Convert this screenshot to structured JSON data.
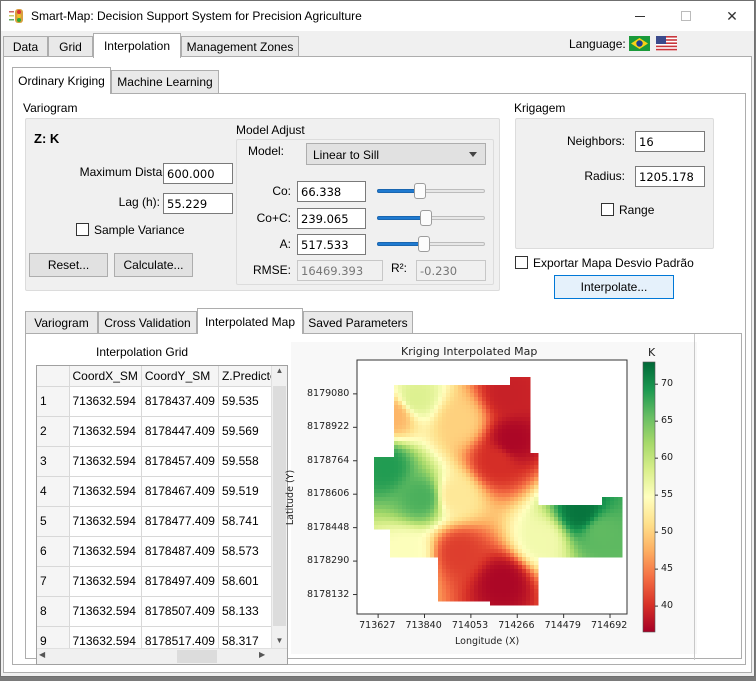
{
  "window": {
    "title": "Smart-Map: Decision Support System for Precision Agriculture",
    "icon": "traffic-light-icon",
    "controls": [
      "minimize-icon",
      "maximize-icon",
      "close-icon"
    ]
  },
  "main_tabs": [
    {
      "label": "Data",
      "active": false
    },
    {
      "label": "Grid",
      "active": false
    },
    {
      "label": "Interpolation",
      "active": true
    },
    {
      "label": "Management Zones",
      "active": false
    }
  ],
  "language": {
    "label": "Language:",
    "flags": [
      "brazil-flag-icon",
      "usa-flag-icon"
    ]
  },
  "method_tabs": [
    {
      "label": "Ordinary Kriging",
      "active": true
    },
    {
      "label": "Machine Learning",
      "active": false
    }
  ],
  "variogram": {
    "group_label": "Variogram",
    "z_label": "Z: K",
    "max_distance_label": "Maximum Distance:",
    "max_distance_value": "600.000",
    "lag_label": "Lag (h):",
    "lag_value": "55.229",
    "sample_variance_label": "Sample Variance",
    "sample_variance_checked": false,
    "reset_button": "Reset...",
    "calculate_button": "Calculate..."
  },
  "model_adjust": {
    "group_label": "Model Adjust",
    "model_label": "Model:",
    "model_value": "Linear to Sill",
    "co_label": "Co:",
    "co_value": "66.338",
    "co_slider_fraction": 0.39,
    "sill_label": "Co+C:",
    "sill_value": "239.065",
    "sill_slider_fraction": 0.45,
    "a_label": "A:",
    "a_value": "517.533",
    "a_slider_fraction": 0.43,
    "rmse_label": "RMSE:",
    "rmse_value": "16469.393",
    "r2_label": "R²:",
    "r2_value": "-0.230"
  },
  "krigagem": {
    "group_label": "Krigagem",
    "neighbors_label": "Neighbors:",
    "neighbors_value": "16",
    "radius_label": "Radius:",
    "radius_value": "1205.178",
    "range_label": "Range",
    "range_checked": false
  },
  "export_std_label": "Exportar Mapa Desvio Padrão",
  "export_std_checked": false,
  "interpolate_button": "Interpolate...",
  "result_tabs": [
    {
      "label": "Variogram",
      "active": false
    },
    {
      "label": "Cross Validation",
      "active": false
    },
    {
      "label": "Interpolated Map",
      "active": true
    },
    {
      "label": "Saved Parameters",
      "active": false
    }
  ],
  "grid_table": {
    "title": "Interpolation Grid",
    "columns": [
      "",
      "CoordX_SM",
      "CoordY_SM",
      "Z.Predicted"
    ],
    "rows": [
      [
        "1",
        "713632.594",
        "8178437.409",
        "59.535"
      ],
      [
        "2",
        "713632.594",
        "8178447.409",
        "59.569"
      ],
      [
        "3",
        "713632.594",
        "8178457.409",
        "59.558"
      ],
      [
        "4",
        "713632.594",
        "8178467.409",
        "59.519"
      ],
      [
        "5",
        "713632.594",
        "8178477.409",
        "58.741"
      ],
      [
        "6",
        "713632.594",
        "8178487.409",
        "58.573"
      ],
      [
        "7",
        "713632.594",
        "8178497.409",
        "58.601"
      ],
      [
        "8",
        "713632.594",
        "8178507.409",
        "58.133"
      ],
      [
        "9",
        "713632.594",
        "8178517.409",
        "58.317"
      ]
    ]
  },
  "chart_data": {
    "type": "heatmap",
    "title": "Kriging Interpolated Map",
    "xlabel": "Longitude (X)",
    "ylabel": "Latitude  (Y)",
    "x_ticks": [
      713627,
      713840,
      714053,
      714266,
      714479,
      714692
    ],
    "y_ticks": [
      8178132,
      8178290,
      8178448,
      8178606,
      8178764,
      8178922,
      8179080
    ],
    "xlim": [
      713530,
      714770
    ],
    "ylim": [
      8178040,
      8179240
    ],
    "colorbar": {
      "label": "K",
      "colormap": "RdYlGn",
      "ticks": [
        40,
        45,
        50,
        55,
        60,
        65,
        70
      ],
      "range": [
        36.5,
        73
      ]
    },
    "colormap_stops": [
      "#a50026",
      "#d73027",
      "#f46d43",
      "#fdae61",
      "#fee08b",
      "#ffffbf",
      "#d9ef8b",
      "#a6d96a",
      "#66bd63",
      "#1a9850",
      "#006837"
    ],
    "field_description": "Irregular field boundary; high K (green) in west and east lobes, low K (red) in north-east and south-central zones, transitional yellow band through the centre.",
    "hotspots": [
      {
        "x": 713660,
        "y": 8178740,
        "value": 69
      },
      {
        "x": 713830,
        "y": 8178590,
        "value": 67
      },
      {
        "x": 714560,
        "y": 8178520,
        "value": 72
      },
      {
        "x": 714650,
        "y": 8178430,
        "value": 66
      },
      {
        "x": 714240,
        "y": 8178860,
        "value": 37
      },
      {
        "x": 714220,
        "y": 8179080,
        "value": 39
      },
      {
        "x": 714170,
        "y": 8178760,
        "value": 40
      },
      {
        "x": 714200,
        "y": 8178190,
        "value": 37
      },
      {
        "x": 714000,
        "y": 8178330,
        "value": 41
      },
      {
        "x": 713800,
        "y": 8179060,
        "value": 58
      },
      {
        "x": 713700,
        "y": 8178980,
        "value": 48
      },
      {
        "x": 713980,
        "y": 8178600,
        "value": 52
      },
      {
        "x": 714000,
        "y": 8178950,
        "value": 50
      },
      {
        "x": 714380,
        "y": 8178390,
        "value": 56
      },
      {
        "x": 713760,
        "y": 8178330,
        "value": 55
      }
    ]
  }
}
